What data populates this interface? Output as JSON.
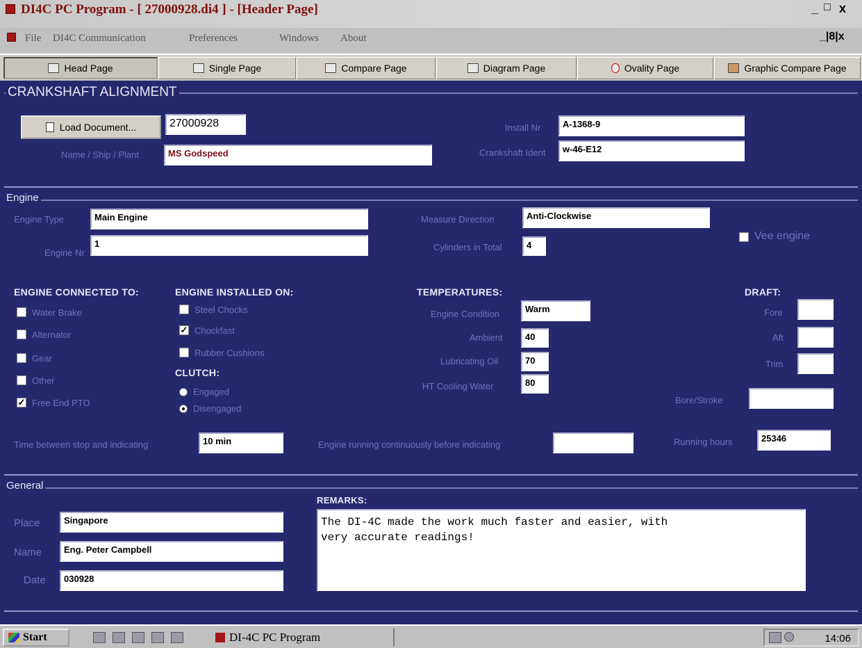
{
  "window": {
    "title": "DI4C PC Program - [ 27000928.di4 ] - [Header Page]",
    "minimize": "_",
    "restore": "□",
    "close": "x",
    "inner_controls": "_|8|x"
  },
  "menu": [
    "File",
    "DI4C Communication",
    "Preferences",
    "Windows",
    "About"
  ],
  "tabs": [
    "Head Page",
    "Single Page",
    "Compare Page",
    "Diagram Page",
    "Ovality Page",
    "Graphic Compare Page"
  ],
  "alignment": {
    "section_title": "CRANKSHAFT ALIGNMENT",
    "load_button": "Load Document...",
    "document_nr": "27000928",
    "name_label": "Name / Ship / Plant",
    "name_value": "MS Godspeed",
    "install_label": "Install Nr",
    "install_value": "A-1368-9",
    "crank_label": "Crankshaft Ident",
    "crank_value": "w-46-E12"
  },
  "engine": {
    "section_title": "Engine",
    "type_label": "Engine Type",
    "type_value": "Main Engine",
    "nr_label": "Engine Nr",
    "nr_value": "1",
    "direction_label": "Measure Direction",
    "direction_value": "Anti-Clockwise",
    "cylinders_label": "Cylinders in Total",
    "cylinders_value": "4",
    "vee_label": "Vee engine",
    "connected_header": "ENGINE CONNECTED TO:",
    "connected": [
      {
        "label": "Water Brake",
        "checked": false
      },
      {
        "label": "Alternator",
        "checked": false
      },
      {
        "label": "Gear",
        "checked": false
      },
      {
        "label": "Other",
        "checked": false
      },
      {
        "label": "Free End PTO",
        "checked": true
      }
    ],
    "installed_header": "ENGINE INSTALLED ON:",
    "installed": [
      {
        "label": "Steel Chocks",
        "checked": false
      },
      {
        "label": "Chockfast",
        "checked": true
      },
      {
        "label": "Rubber Cushions",
        "checked": false
      }
    ],
    "clutch_header": "CLUTCH:",
    "clutch_engaged": "Engaged",
    "clutch_disengaged": "Disengaged",
    "clutch_selected": "Disengaged",
    "temp_header": "TEMPERATURES:",
    "condition_label": "Engine Condition",
    "condition_value": "Warm",
    "ambient_label": "Ambient",
    "ambient_value": "40",
    "lub_label": "Lubricating Oil",
    "lub_value": "70",
    "ht_label": "HT Cooling Water",
    "ht_value": "80",
    "draft_header": "DRAFT:",
    "fore_label": "Fore",
    "aft_label": "Aft",
    "trim_label": "Trim",
    "bore_label": "Bore/Stroke",
    "time_label": "Time between stop and indicating",
    "time_value": "10 min",
    "running_label": "Engine running continuously before indicating",
    "hours_label": "Running hours",
    "hours_value": "25346"
  },
  "general": {
    "section_title": "General",
    "place_label": "Place",
    "place_value": "Singapore",
    "name_label": "Name",
    "name_value": "Eng. Peter Campbell",
    "date_label": "Date",
    "date_value": "030928",
    "remarks_header": "REMARKS:",
    "remarks_line1": "The DI-4C made the work much faster and easier, with",
    "remarks_line2": "very accurate readings!"
  },
  "taskbar": {
    "start": "Start",
    "task": "DI-4C PC Program",
    "clock": "14:06"
  }
}
